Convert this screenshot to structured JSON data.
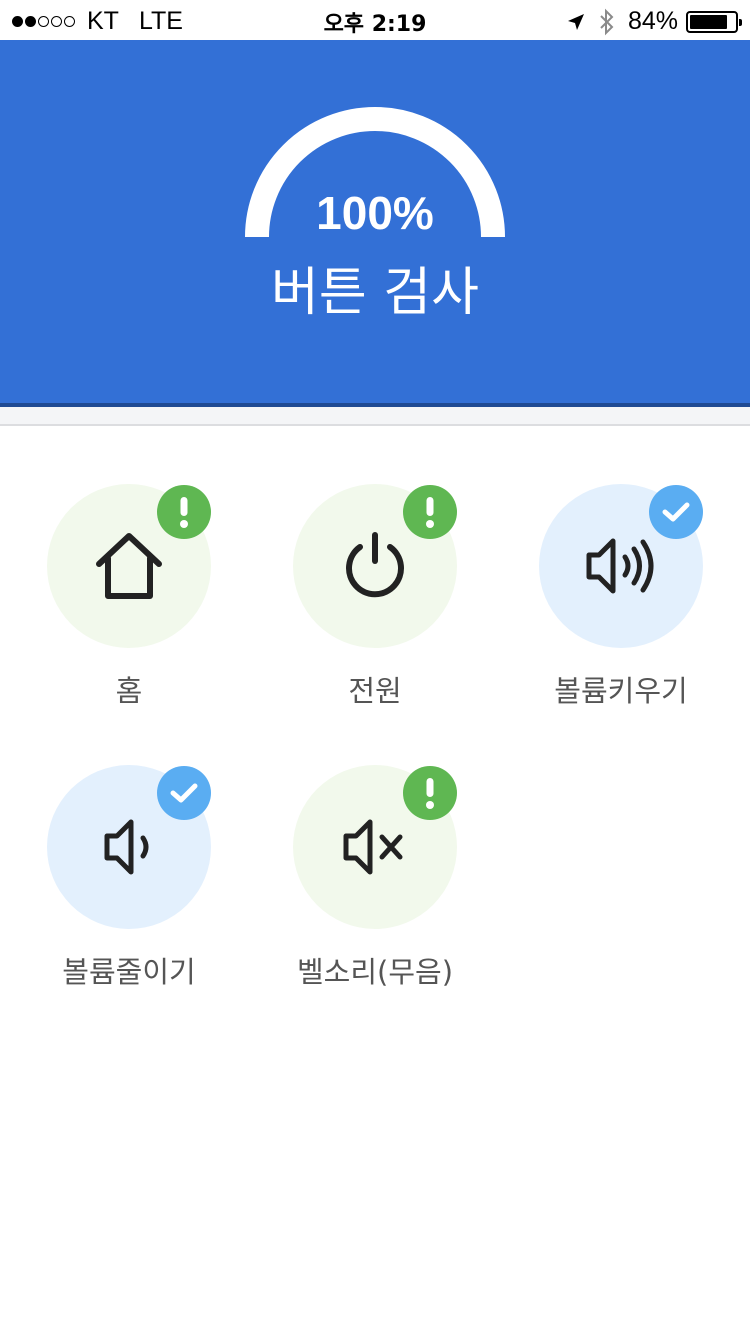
{
  "status_bar": {
    "carrier": "KT",
    "network": "LTE",
    "time": "오후 2:19",
    "battery_percent_label": "84%",
    "battery_level": 0.84,
    "signal_bars_filled": 2,
    "signal_bars_total": 5,
    "icons": [
      "location-arrow-icon",
      "bluetooth-icon",
      "battery-icon"
    ]
  },
  "header": {
    "progress_label": "100%",
    "progress_value": 1.0,
    "title": "버튼 검사",
    "background_color": "#3370d6"
  },
  "buttons": [
    {
      "label": "홈",
      "icon": "home-icon",
      "status": "warning",
      "status_icon": "exclamation-icon"
    },
    {
      "label": "전원",
      "icon": "power-icon",
      "status": "warning",
      "status_icon": "exclamation-icon"
    },
    {
      "label": "볼륨키우기",
      "icon": "volume-up-icon",
      "status": "ok",
      "status_icon": "checkmark-icon"
    },
    {
      "label": "볼륨줄이기",
      "icon": "volume-down-icon",
      "status": "ok",
      "status_icon": "checkmark-icon"
    },
    {
      "label": "벨소리(무음)",
      "icon": "volume-mute-icon",
      "status": "warning",
      "status_icon": "exclamation-icon"
    }
  ],
  "colors": {
    "warning_badge": "#5fb752",
    "warning_circle": "#f2f9ec",
    "ok_badge": "#5aadf2",
    "ok_circle": "#e3f0fd"
  }
}
